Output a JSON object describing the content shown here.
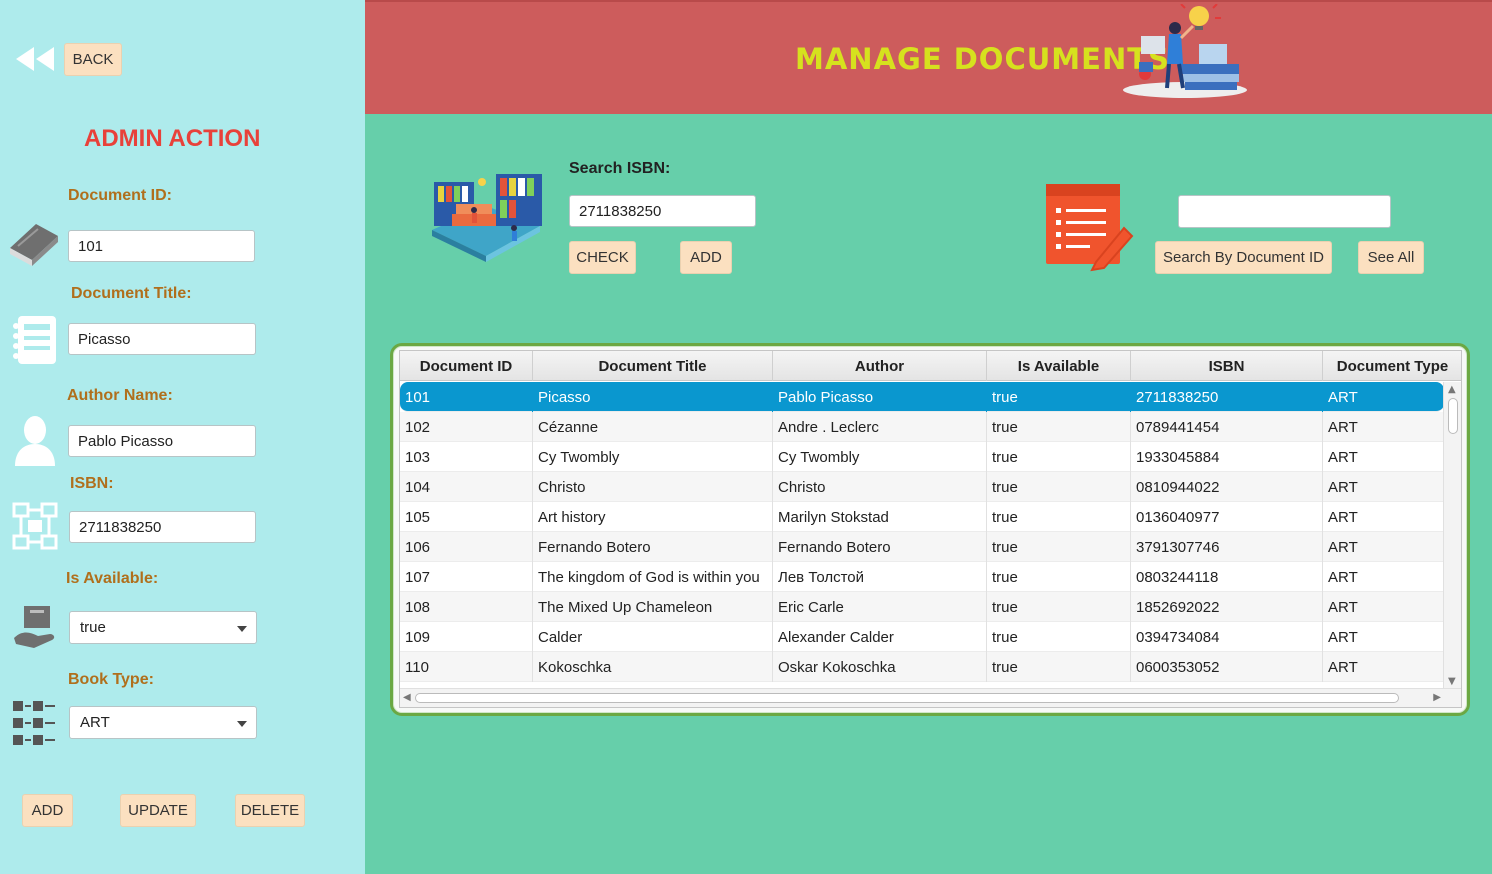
{
  "sidebar": {
    "back_label": "BACK",
    "heading": "ADMIN ACTION",
    "document_id_label": "Document ID:",
    "document_id_value": "101",
    "document_title_label": "Document Title:",
    "document_title_value": "Picasso",
    "author_label": "Author Name:",
    "author_value": "Pablo Picasso",
    "isbn_label": "ISBN:",
    "isbn_value": "2711838250",
    "available_label": "Is Available:",
    "available_value": "true",
    "book_type_label": "Book Type:",
    "book_type_value": "ART",
    "add_label": "ADD",
    "update_label": "UPDATE",
    "delete_label": "DELETE"
  },
  "header": {
    "title": "MANAGE DOCUMENTS"
  },
  "search": {
    "isbn_label": "Search ISBN:",
    "isbn_value": "2711838250",
    "check_label": "CHECK",
    "add_label": "ADD",
    "doc_id_value": "",
    "search_by_id_label": "Search By Document ID",
    "see_all_label": "See All"
  },
  "table": {
    "columns": [
      "Document ID",
      "Document Title",
      "Author",
      "Is Available",
      "ISBN",
      "Document Type"
    ],
    "rows": [
      [
        "101",
        "Picasso",
        "Pablo Picasso",
        "true",
        "2711838250",
        "ART"
      ],
      [
        "102",
        "Cézanne",
        "Andre . Leclerc",
        "true",
        "0789441454",
        "ART"
      ],
      [
        "103",
        "Cy Twombly",
        "Cy Twombly",
        "true",
        "1933045884",
        "ART"
      ],
      [
        "104",
        "Christo",
        "Christo",
        "true",
        "0810944022",
        "ART"
      ],
      [
        "105",
        "Art history",
        "Marilyn Stokstad",
        "true",
        "0136040977",
        "ART"
      ],
      [
        "106",
        "Fernando Botero",
        "Fernando Botero",
        "true",
        "3791307746",
        "ART"
      ],
      [
        "107",
        "The kingdom of God is within you",
        "Лев Толстой",
        "true",
        "0803244118",
        "ART"
      ],
      [
        "108",
        "The Mixed Up Chameleon",
        "Eric Carle",
        "true",
        "1852692022",
        "ART"
      ],
      [
        "109",
        "Calder",
        "Alexander Calder",
        "true",
        "0394734084",
        "ART"
      ],
      [
        "110",
        "Kokoschka",
        "Oskar Kokoschka",
        "true",
        "0600353052",
        "ART"
      ]
    ],
    "selected_row": 0
  },
  "colors": {
    "sidebar_bg": "#aeebec",
    "main_bg": "#66cfaa",
    "header_bg": "#cd5c5c",
    "title_color": "#d6e11e",
    "heading_color": "#e8413a",
    "label_color": "#b06f1c",
    "button_bg": "#fbe0c0",
    "selected_row": "#0a97cf"
  },
  "icons": [
    "back-arrow-icon",
    "book-icon",
    "notebook-icon",
    "user-icon",
    "network-icon",
    "hand-box-icon",
    "category-grid-icon",
    "library-illustration-icon",
    "document-edit-icon",
    "header-illustration-icon"
  ]
}
